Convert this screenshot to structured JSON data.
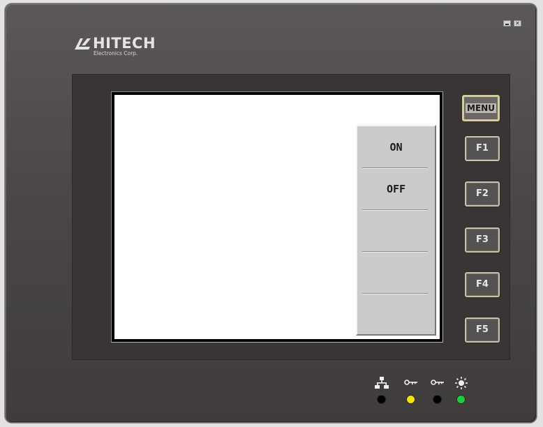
{
  "window_controls": {
    "minimize_label": "",
    "close_label": "✕"
  },
  "brand": {
    "name": "HITECH",
    "subtitle": "Electronics Corp."
  },
  "popup_menu": {
    "items": [
      {
        "label": "ON"
      },
      {
        "label": "OFF"
      },
      {
        "label": ""
      },
      {
        "label": ""
      },
      {
        "label": ""
      }
    ]
  },
  "function_keys": [
    {
      "label": "MENU"
    },
    {
      "label": "F1"
    },
    {
      "label": "F2"
    },
    {
      "label": "F3"
    },
    {
      "label": "F4"
    },
    {
      "label": "F5"
    }
  ],
  "status_indicators": [
    {
      "icon": "network-icon",
      "led_color": "#000000"
    },
    {
      "icon": "key-icon",
      "led_color": "#f2e600"
    },
    {
      "icon": "key-icon",
      "led_color": "#000000"
    },
    {
      "icon": "power-light-icon",
      "led_color": "#19d03a"
    }
  ],
  "colors": {
    "device_body": "#4a4746",
    "bezel": "#383534",
    "screen": "#ffffff",
    "fkey_border": "#c9c2a9"
  }
}
